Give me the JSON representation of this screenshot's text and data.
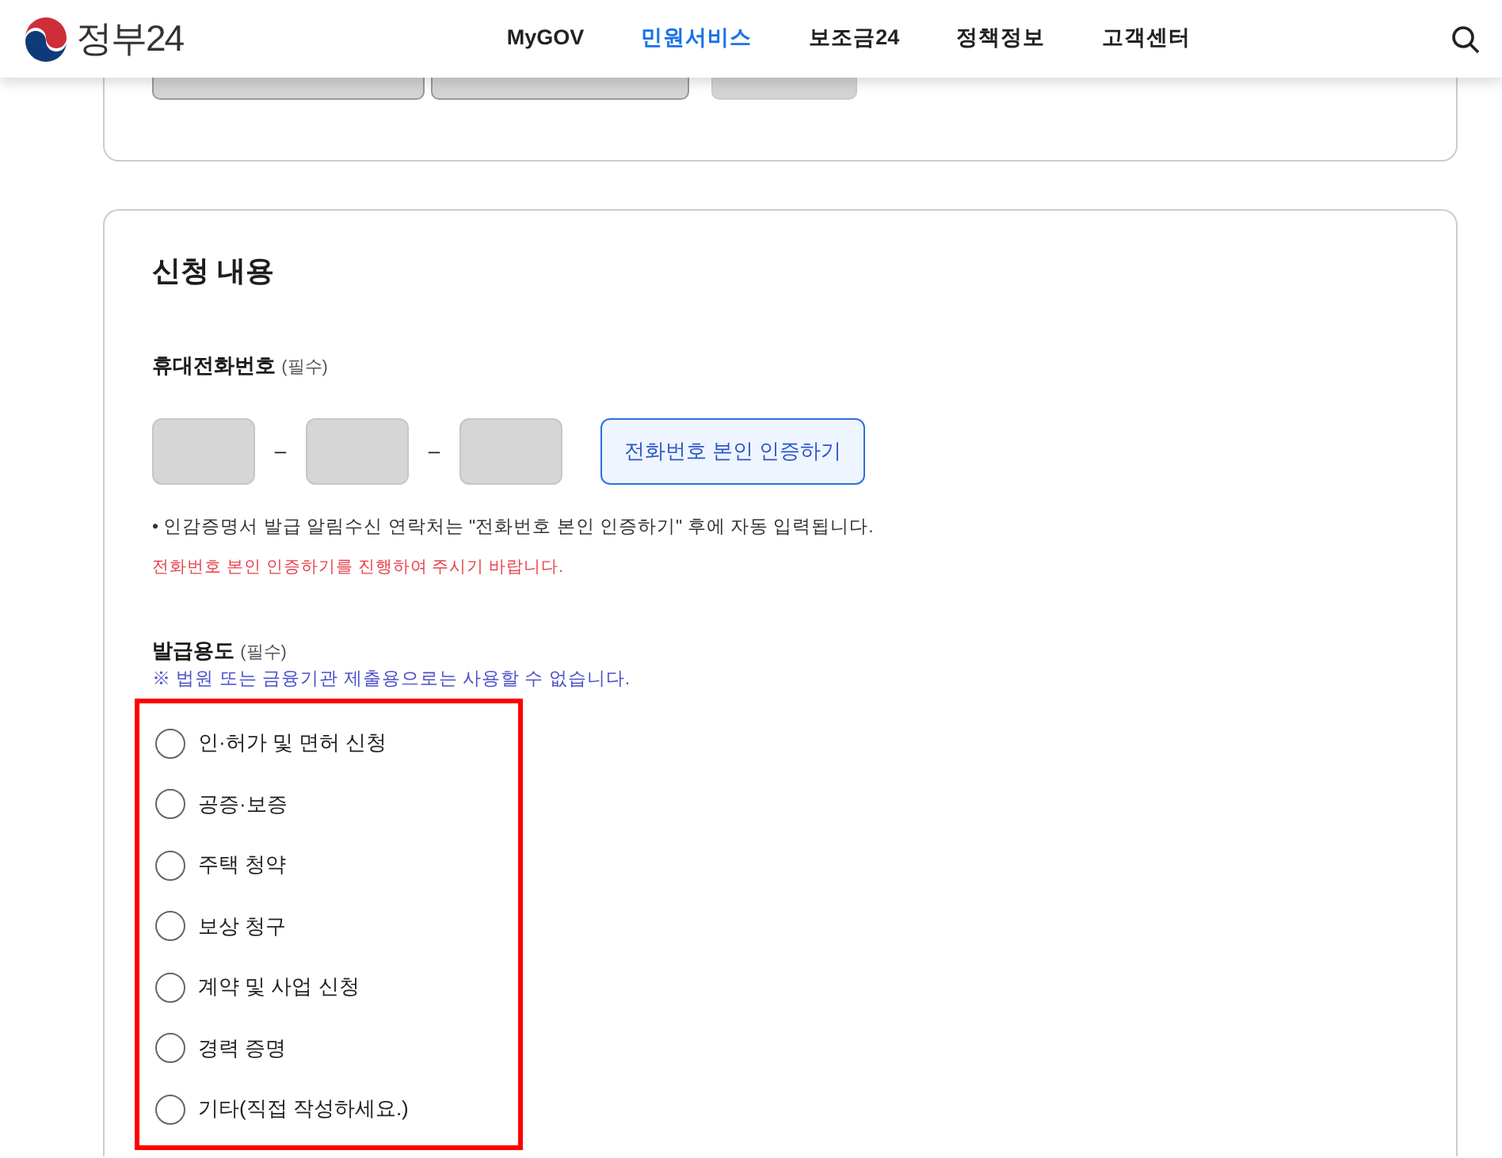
{
  "header": {
    "logo_text": "정부24",
    "nav": [
      {
        "label": "MyGOV",
        "selected": false
      },
      {
        "label": "민원서비스",
        "selected": true
      },
      {
        "label": "보조금24",
        "selected": false
      },
      {
        "label": "정책정보",
        "selected": false
      },
      {
        "label": "고객센터",
        "selected": false
      }
    ]
  },
  "previous_section": {
    "buttons": [
      {
        "kind": "button"
      },
      {
        "kind": "button"
      },
      {
        "kind": "button"
      }
    ]
  },
  "application": {
    "title": "신청 내용",
    "phone": {
      "label": "휴대전화번호",
      "required": "(필수)",
      "separator": "–",
      "inputs": [
        {
          "kind": "digits"
        },
        {
          "kind": "digits"
        },
        {
          "kind": "digits"
        }
      ],
      "verify_button": "전화번호 본인 인증하기",
      "note": "• 인감증명서 발급 알림수신 연락처는 \"전화번호 본인 인증하기\" 후에 자동 입력됩니다.",
      "warning": "전화번호 본인 인증하기를 진행하여 주시기 바랍니다."
    },
    "purpose": {
      "label": "발급용도",
      "required": "(필수)",
      "note": "※ 법원 또는 금융기관 제출용으로는 사용할 수 없습니다.",
      "highlighted": true,
      "options": [
        {
          "label": "인·허가 및 면허 신청",
          "selected": false
        },
        {
          "label": "공증·보증",
          "selected": false
        },
        {
          "label": "주택 청약",
          "selected": false
        },
        {
          "label": "보상 청구",
          "selected": false
        },
        {
          "label": "계약 및 사업 신청",
          "selected": false
        },
        {
          "label": "경력 증명",
          "selected": false
        },
        {
          "label": "기타(직접 작성하세요.)",
          "selected": false
        }
      ]
    }
  }
}
